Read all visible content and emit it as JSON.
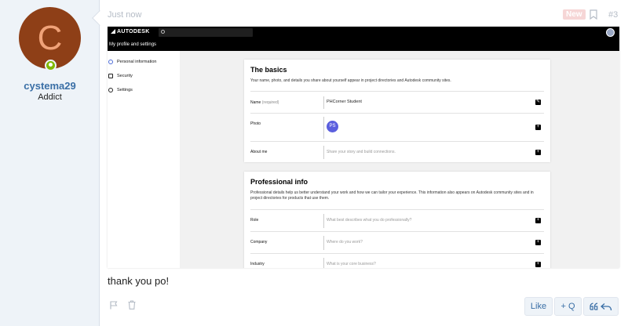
{
  "user": {
    "avatar_letter": "C",
    "username": "cystema29",
    "title": "Addict",
    "avatar_color": "#8e3f17",
    "online_color": "#7fb900"
  },
  "post": {
    "time": "Just now",
    "badge": "New",
    "number": "#3",
    "text": "thank you po!"
  },
  "screenshot": {
    "brand": "AUTODESK",
    "subheader": "My profile and settings",
    "sidebar": [
      {
        "label": "Personal information",
        "icon": "user-icon"
      },
      {
        "label": "Security",
        "icon": "lock-icon"
      },
      {
        "label": "Settings",
        "icon": "gear-icon"
      }
    ],
    "basics": {
      "title": "The basics",
      "description": "Your name, photo, and details you share about yourself appear in project directories and Autodesk community sites.",
      "name_label": "Name",
      "name_required": "(required)",
      "name_value": "PHCorner Student",
      "photo_label": "Photo",
      "photo_initials": "PS",
      "about_label": "About me",
      "about_placeholder": "Share your story and build connections."
    },
    "professional": {
      "title": "Professional info",
      "description": "Professional details help us better understand your work and how we can tailor your experience. This information also appears on Autodesk community sites and in project directories for products that use them.",
      "rows": [
        {
          "label": "Role",
          "placeholder": "What best describes what you do professionally?"
        },
        {
          "label": "Company",
          "placeholder": "Where do you work?"
        },
        {
          "label": "Industry",
          "placeholder": "What is your core business?"
        }
      ]
    }
  },
  "actions": {
    "like": "Like",
    "quote": "+ Q",
    "reply_icon": "quote-reply-icon"
  },
  "colors": {
    "link": "#3a6fa6",
    "sidebar_bg": "#eef3f8"
  }
}
